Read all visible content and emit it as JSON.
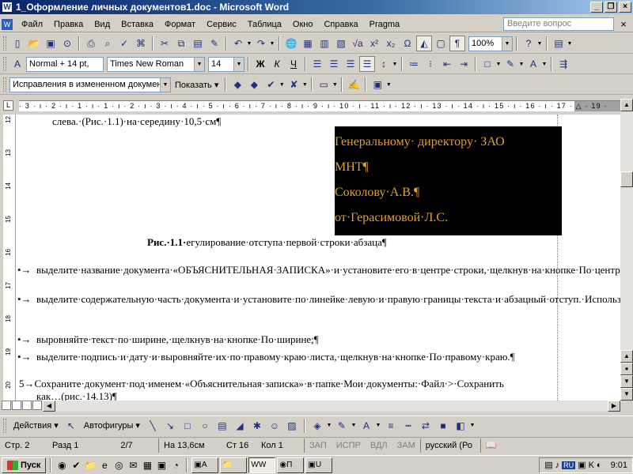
{
  "window": {
    "title": "1_Оформление личных документов1.doc - Microsoft Word",
    "min_glyph": "_",
    "max_glyph": "❐",
    "close_glyph": "×"
  },
  "menu": {
    "items": [
      "Файл",
      "Правка",
      "Вид",
      "Вставка",
      "Формат",
      "Сервис",
      "Таблица",
      "Окно",
      "Справка",
      "Pragma"
    ],
    "help_placeholder": "Введите вопрос",
    "close_glyph": "×"
  },
  "standard_toolbar": {
    "zoom": "100%",
    "icons": [
      "new-icon",
      "open-icon",
      "save-icon",
      "permission-icon",
      "print-icon",
      "print-preview-icon",
      "spelling-icon",
      "research-icon",
      "cut-icon",
      "copy-icon",
      "paste-icon",
      "format-painter-icon",
      "undo-icon",
      "redo-icon",
      "hyperlink-icon",
      "tables-borders-icon",
      "insert-table-icon",
      "insert-excel-icon",
      "equation-icon",
      "superscript-icon",
      "subscript-icon",
      "omega-icon",
      "drawing-icon",
      "document-map-icon",
      "show-formatting-icon",
      "help-icon",
      "read-icon"
    ]
  },
  "formatting_toolbar": {
    "style": "Normal + 14 pt, ",
    "font": "Times New Roman",
    "size": "14",
    "bold": "Ж",
    "italic": "К",
    "underline": "Ч"
  },
  "reviewing_toolbar": {
    "display_for_review": "Исправления в измененном документ",
    "show_label": "Показать"
  },
  "ruler": {
    "ticks": "· 3 · ı · 2 · ı · 1 · ı · 1 · ı · 2 · ı · 3 · ı · 4 · ı · 5 · ı · 6 · ı · 7 · ı · 8 · ı · 9 · ı · 10 · ı · 11 · ı · 12 · ı · 13 · ı · 14 · ı · 15 · ı · 16 · ı · 17 · △ · 19 ·"
  },
  "vruler": [
    "12",
    "13",
    "14",
    "15",
    "16",
    "17",
    "18",
    "19",
    "20"
  ],
  "document": {
    "top_line": "слева.·(Рис.·1.1)·на·середину·10,5·см¶",
    "box_lines": [
      "Генеральному·  директору·  ЗАО",
      "МНТ¶",
      "Соколову·А.В.¶",
      "от·Герасимовой·Л.С."
    ],
    "caption_bold": "Рис.·1.1·",
    "caption_rest": "егулирование·отступа·первой·строки·абзаца¶",
    "bullets": [
      "выделите·название·документа·«ОБЪЯСНИТЕЛЬНАЯ·ЗАПИСКА»·и·установите·его·в·центре·строки,·щелкнув·на·кнопке·По·центру;¶",
      "выделите·содержательную·часть·документа·и·установите·по·линейке·левую·и·правую·границы·текста·и·абзацный·отступ.·Используйте·для·этого·маркеры·По·левому·краю,·По·правому·краю·и·Отступ·первой·строки;¶",
      "выровняйте·текст·по·ширине,·щелкнув·на·кнопке·По·ширине;¶",
      "выделите·подпись·и·дату·и·выровняйте·их·по·правому·краю·листа,·щелкнув·на·кнопке·По·правому·краю.¶"
    ],
    "bullet_marker": "•→",
    "step_marker": "5→",
    "step_line1": "Сохраните·документ·под·именем·«Объяснительная·записка»·в·папке·Мои·документы:·Файл·>·Сохранить",
    "step_line2": "как…(рис.·14.13)¶"
  },
  "drawing_toolbar": {
    "actions_label": "Действия",
    "autoshapes_label": "Автофигуры"
  },
  "status": {
    "page": "Стр. 2",
    "section": "Разд 1",
    "pages": "2/7",
    "at": "На 13,6см",
    "line": "Ст 16",
    "col": "Кол 1",
    "rec": "ЗАП",
    "trk": "ИСПР",
    "ext": "ВДЛ",
    "ovr": "ЗАМ",
    "language": "русский (Ро"
  },
  "taskbar": {
    "start_label": "Пуск",
    "tasks": [
      "А",
      "",
      "W",
      "П",
      "U"
    ],
    "lang": "RU",
    "clock": "9:01"
  },
  "colors": {
    "highlight_text": "#e0a030",
    "title_bar": "#0a246a"
  }
}
